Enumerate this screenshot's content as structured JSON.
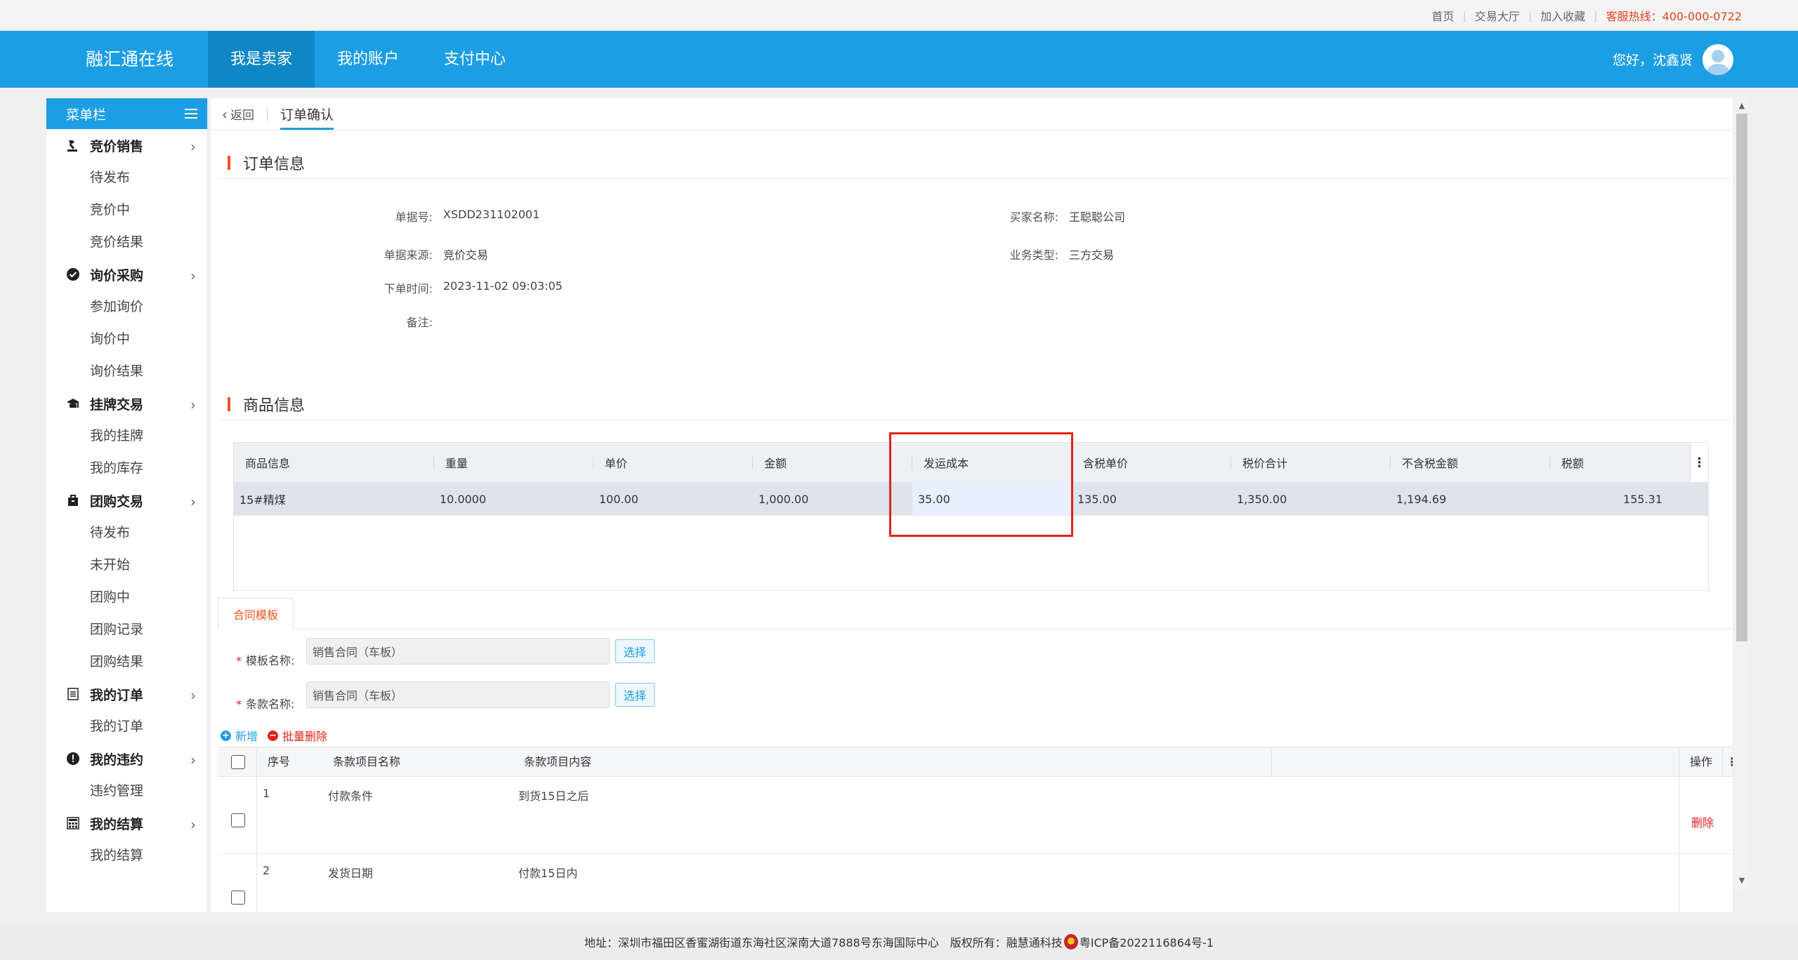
{
  "topbar": {
    "links": [
      "首页",
      "交易大厅",
      "加入收藏"
    ],
    "hotline": "客服热线：400-000-0722"
  },
  "header": {
    "brand": "融汇通在线",
    "nav": [
      "我是卖家",
      "我的账户",
      "支付中心"
    ],
    "active_nav": "我是卖家",
    "greeting": "您好，沈鑫贤"
  },
  "sidebar": {
    "title": "菜单栏",
    "groups": [
      {
        "label": "竞价销售",
        "icon": "gavel-icon",
        "items": [
          "待发布",
          "竞价中",
          "竞价结果"
        ]
      },
      {
        "label": "询价采购",
        "icon": "check-circle-icon",
        "items": [
          "参加询价",
          "询价中",
          "询价结果"
        ]
      },
      {
        "label": "挂牌交易",
        "icon": "listing-icon",
        "items": [
          "我的挂牌",
          "我的库存"
        ]
      },
      {
        "label": "团购交易",
        "icon": "bag-icon",
        "items": [
          "待发布",
          "未开始",
          "团购中",
          "团购记录",
          "团购结果"
        ]
      },
      {
        "label": "我的订单",
        "icon": "document-icon",
        "items": [
          "我的订单"
        ]
      },
      {
        "label": "我的违约",
        "icon": "alert-icon",
        "items": [
          "违约管理"
        ]
      },
      {
        "label": "我的结算",
        "icon": "calculator-icon",
        "items": [
          "我的结算"
        ]
      }
    ]
  },
  "tabs": {
    "back": "返回",
    "active": "订单确认"
  },
  "order_info": {
    "title": "订单信息",
    "fields": {
      "bill_no_label": "单据号:",
      "bill_no": "XSDD231102001",
      "buyer_label": "买家名称:",
      "buyer": "王聪聪公司",
      "source_label": "单据来源:",
      "source": "竞价交易",
      "biz_type_label": "业务类型:",
      "biz_type": "三方交易",
      "order_time_label": "下单时间:",
      "order_time": "2023-11-02 09:03:05",
      "remark_label": "备注:",
      "remark": ""
    }
  },
  "goods": {
    "title": "商品信息",
    "columns": [
      "商品信息",
      "重量",
      "单价",
      "金额",
      "发运成本",
      "含税单价",
      "税价合计",
      "不含税金额",
      "税额"
    ],
    "rows": [
      [
        "15#精煤",
        "10.0000",
        "100.00",
        "1,000.00",
        "35.00",
        "135.00",
        "1,350.00",
        "1,194.69",
        "155.31"
      ]
    ]
  },
  "contract": {
    "tab": "合同模板",
    "template_label": "模板名称:",
    "template_value": "销售合同（车板）",
    "terms_label": "条款名称:",
    "terms_value": "销售合同（车板）",
    "select_label": "选择",
    "add_label": "新增",
    "batch_delete_label": "批量删除",
    "columns": {
      "no": "序号",
      "name": "条款项目名称",
      "content": "条款项目内容",
      "action": "操作"
    },
    "rows": [
      {
        "no": "1",
        "name": "付款条件",
        "content": "到货15日之后",
        "action": "删除"
      },
      {
        "no": "2",
        "name": "发货日期",
        "content": "付款15日内",
        "action": ""
      }
    ]
  },
  "footer": {
    "address": "地址：深圳市福田区香蜜湖街道东海社区深南大道7888号东海国际中心",
    "copyright": "版权所有：融慧通科技",
    "icp": "粤ICP备2022116864号-1"
  }
}
